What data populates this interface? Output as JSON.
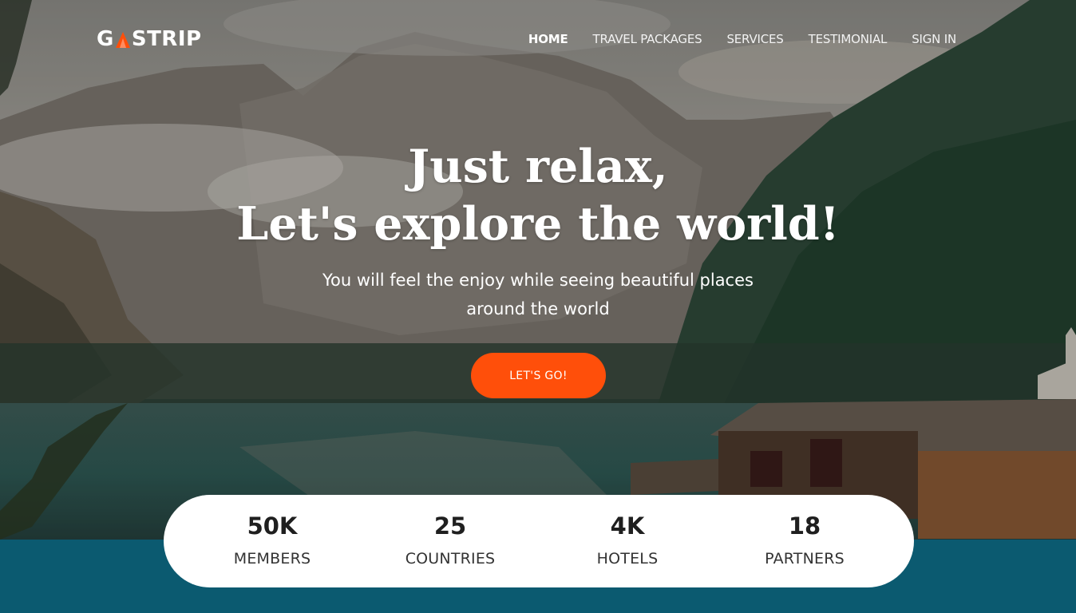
{
  "brand": {
    "logo_text_left": "G",
    "logo_text_right": "STRIP",
    "accent": "#ff4f0a"
  },
  "nav": {
    "items": [
      {
        "label": "HOME",
        "active": true
      },
      {
        "label": "TRAVEL PACKAGES",
        "active": false
      },
      {
        "label": "SERVICES",
        "active": false
      },
      {
        "label": "TESTIMONIAL",
        "active": false
      },
      {
        "label": "SIGN IN",
        "active": false
      }
    ]
  },
  "hero": {
    "title_line1": "Just relax,",
    "title_line2": "Let's explore the world!",
    "subtitle_line1": "You will feel the enjoy while seeing beautiful places",
    "subtitle_line2": "around the world",
    "cta_label": "LET'S GO!"
  },
  "stats": [
    {
      "value": "50K",
      "label": "MEMBERS"
    },
    {
      "value": "25",
      "label": "COUNTRIES"
    },
    {
      "value": "4K",
      "label": "HOTELS"
    },
    {
      "value": "18",
      "label": "PARTNERS"
    }
  ],
  "colors": {
    "footer_band": "#0b5a70",
    "cta_bg": "#ff4f0a",
    "card_bg": "#ffffff"
  }
}
